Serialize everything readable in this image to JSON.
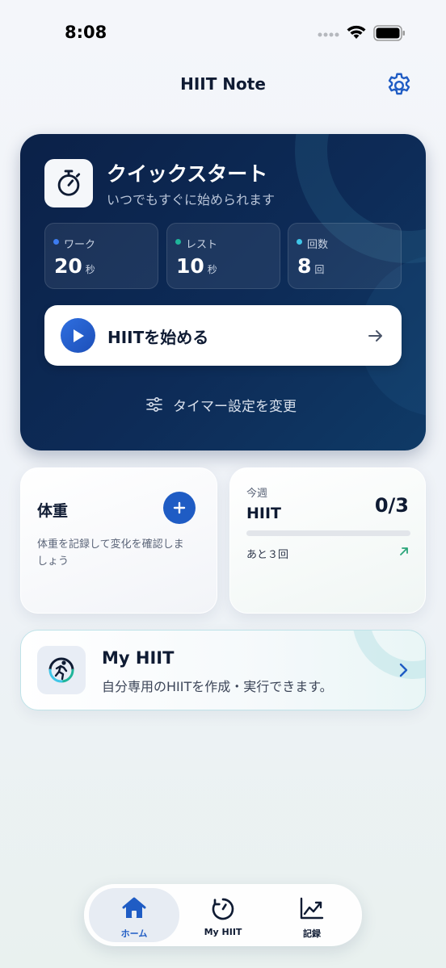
{
  "status_bar": {
    "time": "8:08"
  },
  "header": {
    "title": "HIIT Note"
  },
  "quick_start": {
    "title": "クイックスタート",
    "subtitle": "いつでもすぐに始められます",
    "stats": [
      {
        "label": "ワーク",
        "value": "20",
        "unit": "秒",
        "dot_color": "#3d7cf0"
      },
      {
        "label": "レスト",
        "value": "10",
        "unit": "秒",
        "dot_color": "#1fb59a"
      },
      {
        "label": "回数",
        "value": "8",
        "unit": "回",
        "dot_color": "#3fc6e8"
      }
    ],
    "start_button": "HIITを始める",
    "timer_settings": "タイマー設定を変更"
  },
  "weight_card": {
    "title": "体重",
    "description": "体重を記録して変化を確認しましょう"
  },
  "week_card": {
    "label": "今週",
    "title": "HIIT",
    "count": "0/3",
    "progress": 0,
    "remaining": "あと３回"
  },
  "my_hiit_card": {
    "title": "My HIIT",
    "description": "自分専用のHIITを作成・実行できます。"
  },
  "tab_bar": {
    "tabs": [
      {
        "label": "ホーム",
        "icon": "home-icon",
        "active": true
      },
      {
        "label": "My HIIT",
        "icon": "timer-icon",
        "active": false
      },
      {
        "label": "記録",
        "icon": "chart-icon",
        "active": false
      }
    ]
  },
  "colors": {
    "accent": "#1f5cc4",
    "card_dark": "#0b2148",
    "success": "#2ba57a"
  }
}
